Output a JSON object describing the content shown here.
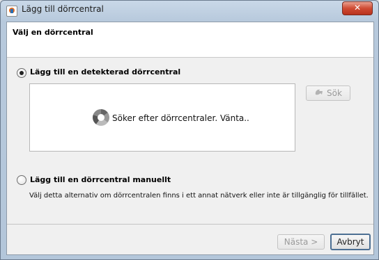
{
  "window": {
    "title": "Lägg till dörrcentral",
    "close_label": "✕"
  },
  "header": {
    "title": "Välj en dörrcentral"
  },
  "options": {
    "detected": {
      "label": "Lägg till en detekterad dörrcentral",
      "selected": true,
      "search_status": "Söker efter dörrcentraler. Vänta..",
      "search_button": "Sök"
    },
    "manual": {
      "label": "Lägg till en dörrcentral manuellt",
      "selected": false,
      "description": "Välj detta alternativ om dörrcentralen finns i ett annat nätverk eller inte är tillgänglig för tillfället."
    }
  },
  "footer": {
    "next_button": "Nästa >",
    "cancel_button": "Avbryt"
  },
  "colors": {
    "title_bar": "#b7c9dc",
    "close_button": "#cf4b33",
    "dialog_bg": "#f0f0f0",
    "default_button_border": "#4c6f93"
  },
  "icons": {
    "app": "java-cup-icon",
    "spinner": "loading-spinner-icon",
    "search": "search-icon"
  }
}
